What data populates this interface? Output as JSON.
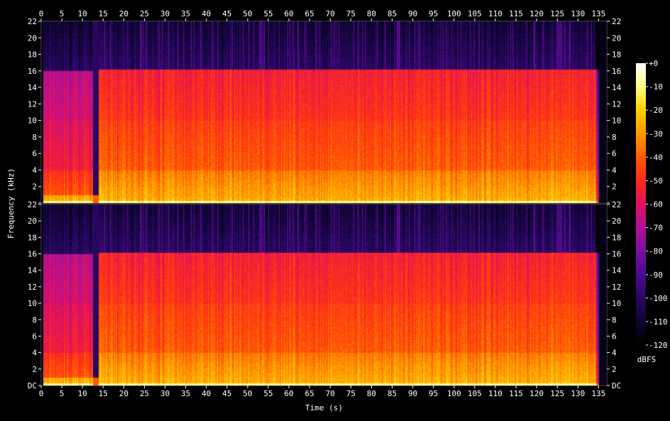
{
  "chart_data": {
    "type": "heatmap",
    "xlabel": "Time (s)",
    "ylabel": "Frequency (kHz)",
    "xlim": [
      0,
      137
    ],
    "ylim": [
      0,
      22
    ],
    "x_ticks": [
      0,
      5,
      10,
      15,
      20,
      25,
      30,
      35,
      40,
      45,
      50,
      55,
      60,
      65,
      70,
      75,
      80,
      85,
      90,
      95,
      100,
      105,
      110,
      115,
      120,
      125,
      130,
      135
    ],
    "y_ticks": [
      "DC",
      "2",
      "4",
      "6",
      "8",
      "10",
      "12",
      "14",
      "16",
      "18",
      "20",
      "22"
    ],
    "channels": 2,
    "colorbar": {
      "label": "dBFS",
      "range": [
        -120,
        0
      ],
      "ticks": [
        "+0",
        "-10",
        "-20",
        "-30",
        "-40",
        "-50",
        "-60",
        "-70",
        "-80",
        "-90",
        "-100",
        "-110",
        "-120"
      ],
      "colormap": [
        "#000000",
        "#0a0530",
        "#2a0660",
        "#4a0a90",
        "#7a10a0",
        "#b0109a",
        "#e01060",
        "#ff2a1a",
        "#ff5a00",
        "#ff9a00",
        "#ffd000",
        "#ffff80",
        "#ffffff"
      ]
    },
    "content": {
      "audio_start_s": 0.5,
      "intro_end_s": 12.5,
      "gap_s": [
        12.5,
        13.8
      ],
      "audio_end_s": 134.0,
      "lowpass_cutoff_khz": 16.2,
      "intro_cutoff_khz": 16.0,
      "band_emphasis_khz": [
        [
          0,
          4,
          -25
        ],
        [
          4,
          10,
          -42
        ],
        [
          10,
          16.2,
          -52
        ],
        [
          16.2,
          22,
          -110
        ]
      ]
    }
  }
}
